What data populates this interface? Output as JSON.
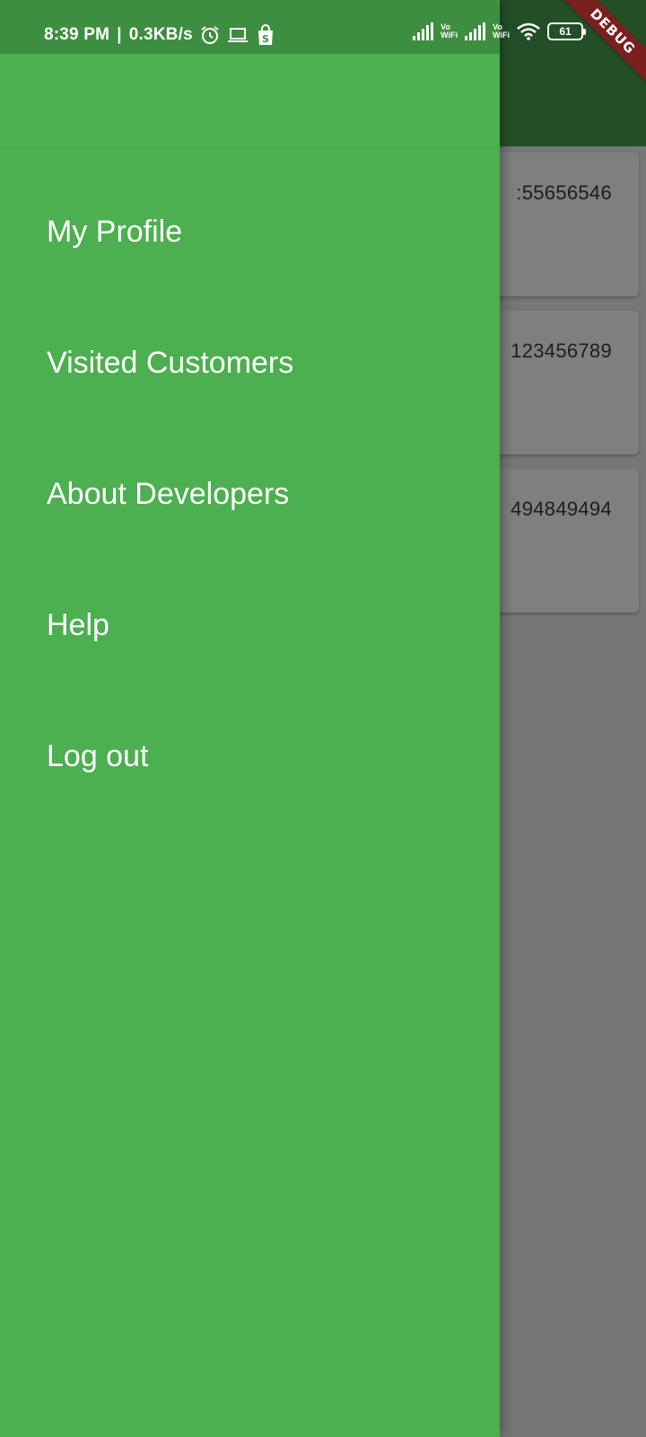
{
  "status_bar": {
    "time": "8:39 PM",
    "speed": "0.3KB/s",
    "vo_top": "Vo",
    "vo_bottom": "WiFi",
    "battery": "61"
  },
  "debug_banner": "DEBUG",
  "cards": [
    {
      "phone": ":55656546"
    },
    {
      "phone": "123456789"
    },
    {
      "phone": "494849494"
    }
  ],
  "drawer": {
    "items": [
      {
        "label": "My Profile"
      },
      {
        "label": "Visited Customers"
      },
      {
        "label": "About Developers"
      },
      {
        "label": "Help"
      },
      {
        "label": "Log out"
      }
    ]
  },
  "colors": {
    "drawer": "#4caf50",
    "app_bar": "#234f27",
    "scrim": "#777777",
    "debug": "#7a1e1e"
  }
}
